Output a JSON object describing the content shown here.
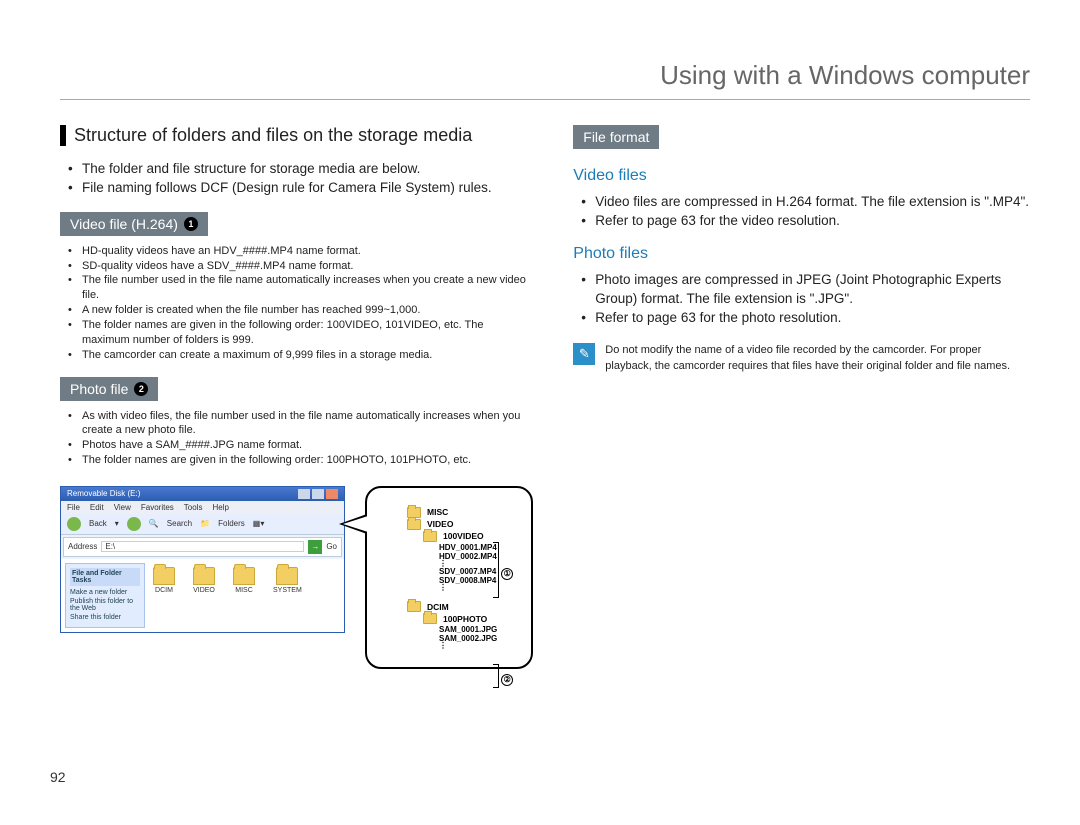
{
  "page": {
    "title": "Using with a Windows computer",
    "number": "92"
  },
  "left": {
    "heading": "Structure of folders and files on the storage media",
    "intro": [
      "The folder and file structure for storage media are below.",
      "File naming follows DCF (Design rule for Camera File System) rules."
    ],
    "video_pill": "Video file (H.264)",
    "video_bullets": [
      "HD-quality videos have an HDV_####.MP4 name format.",
      "SD-quality videos have a SDV_####.MP4 name format.",
      "The file number used in the file name automatically increases when you create a new video file.",
      "A new folder is created when the file number has reached 999~1,000.",
      "The folder names are given in the following order: 100VIDEO, 101VIDEO, etc. The maximum number of folders  is 999.",
      "The camcorder can create a maximum of 9,999 files in a storage media."
    ],
    "photo_pill": "Photo file",
    "photo_bullets": [
      "As with video files, the file number used in the file name automatically increases when you create a new photo file.",
      "Photos have a SAM_####.JPG name format.",
      "The folder names are given in the following order: 100PHOTO, 101PHOTO, etc."
    ]
  },
  "right": {
    "pill": "File format",
    "video_heading": "Video files",
    "video_bullets": [
      "Video files are compressed in H.264 format. The file extension is \".MP4\".",
      "Refer to page 63 for the video resolution."
    ],
    "photo_heading": "Photo files",
    "photo_bullets": [
      "Photo images are compressed in JPEG (Joint Photographic Experts Group) format. The file extension is \".JPG\".",
      "Refer to page 63 for the photo resolution."
    ],
    "note": "Do not modify the name of a video file recorded by the camcorder. For proper playback, the camcorder requires that files have their original folder and file names."
  },
  "explorer": {
    "title": "Removable Disk (E:)",
    "menu": [
      "File",
      "Edit",
      "View",
      "Favorites",
      "Tools",
      "Help"
    ],
    "toolbar": {
      "back": "Back",
      "search": "Search",
      "folders": "Folders"
    },
    "address_label": "Address",
    "address_value": "E:\\",
    "go": "Go",
    "sidebar_title": "File and Folder Tasks",
    "sidebar_items": [
      "Make a new folder",
      "Publish this folder to the Web",
      "Share this folder"
    ],
    "folders": [
      "DCIM",
      "VIDEO",
      "MISC",
      "SYSTEM"
    ]
  },
  "tree": {
    "misc": "MISC",
    "video": "VIDEO",
    "video_sub": "100VIDEO",
    "vfiles": [
      "HDV_0001.MP4",
      "HDV_0002.MP4",
      "SDV_0007.MP4",
      "SDV_0008.MP4"
    ],
    "dcim": "DCIM",
    "dcim_sub": "100PHOTO",
    "pfiles": [
      "SAM_0001.JPG",
      "SAM_0002.JPG"
    ],
    "ref1": "①",
    "ref2": "②"
  }
}
